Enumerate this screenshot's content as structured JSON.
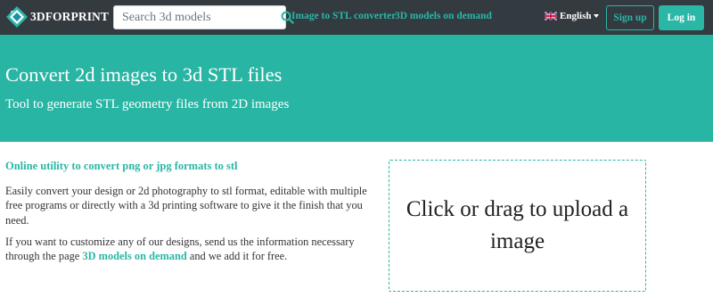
{
  "header": {
    "logo_text": "3DFORPRINT",
    "search_placeholder": "Search 3d models",
    "nav_links": [
      "Image to STL converter",
      "3D models on demand"
    ],
    "language": "English",
    "signup_label": "Sign up",
    "login_label": "Log in"
  },
  "hero": {
    "title": "Convert 2d images to 3d STL files",
    "subtitle": "Tool to generate STL geometry files from 2D images"
  },
  "main": {
    "heading": "Online utility to convert png or jpg formats to stl",
    "paragraph1": "Easily convert your design or 2d photography to stl format, editable with multiple free programs or directly with a 3d printing software to give it the finish that you need.",
    "paragraph2_before": "If you want to customize any of our designs, send us the information necessary through the page ",
    "paragraph2_link": "3D models on demand",
    "paragraph2_after": " and we add it for free.",
    "upload_text": "Click or drag to upload a image"
  },
  "icons": {
    "logo": "logo-mark-icon",
    "search": "search-icon",
    "flag": "uk-flag-icon",
    "caret": "caret-down-icon"
  },
  "colors": {
    "navbar": "#333a40",
    "accent": "#2ab7a5",
    "hero": "#28b5a3"
  }
}
